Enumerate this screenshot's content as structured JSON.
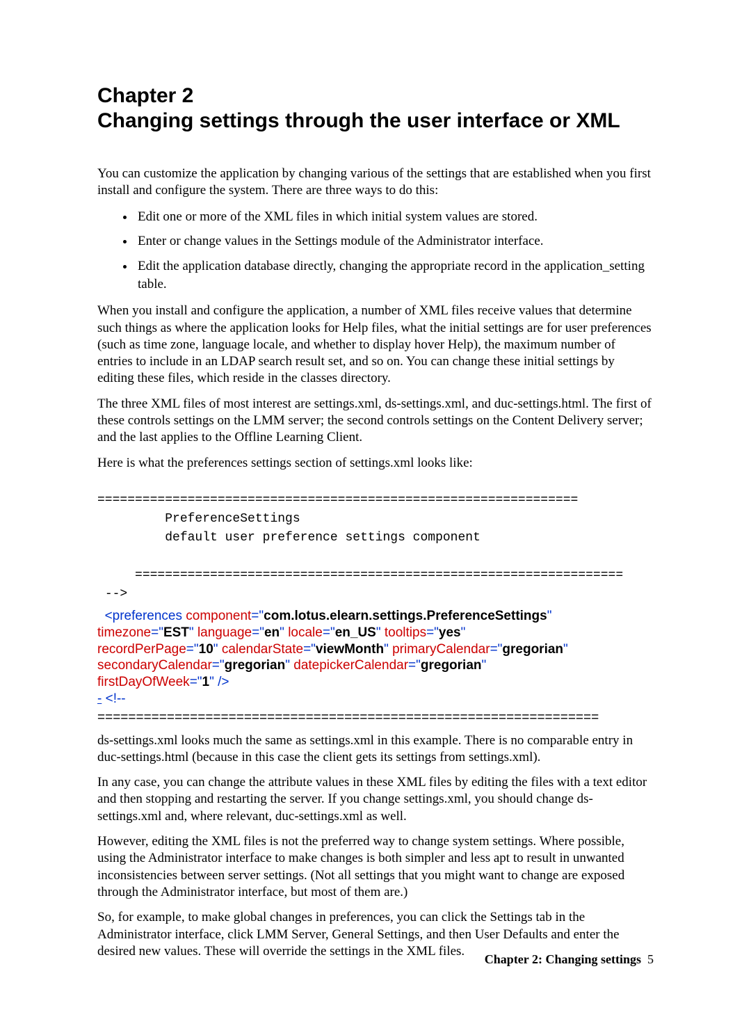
{
  "heading": {
    "chapter": "Chapter 2",
    "title": "Changing settings through the user interface or XML"
  },
  "intro": "You can customize the application by changing various of the settings that are established when you first install and configure the system. There are three ways to do this:",
  "bullets": [
    "Edit one or more of the XML files in which initial system values are stored.",
    "Enter or change values in the Settings module of the Administrator interface.",
    "Edit the application database directly, changing the appropriate record in the application_setting table."
  ],
  "paragraphs": {
    "p1": "When you install and configure the application, a number of XML files receive values that determine such things as where the application looks for Help files, what the initial settings are for user preferences (such as time zone, language locale, and whether to display hover Help), the maximum number of entries to include in an LDAP search result set, and so on.  You can change these initial settings by editing these files, which reside in the classes directory.",
    "p2": "The three XML files of most interest are settings.xml, ds-settings.xml, and duc-settings.html. The first of these controls settings on the LMM server; the second controls settings on the Content Delivery server; and the last applies to the Offline Learning Client.",
    "p3": "Here is what the preferences settings section of settings.xml looks like:"
  },
  "code": {
    "rule": "================================================================",
    "rule2": "=================================================================",
    "line1": "PreferenceSettings",
    "line2": "default user preference settings component",
    "end": "-->"
  },
  "xml": {
    "tag_open": "<preferences",
    "attr1_name": "component",
    "attr1_val": "com.lotus.elearn.settings.PreferenceSettings",
    "attr2_name": "timezone",
    "attr2_val": "EST",
    "attr3_name": "language",
    "attr3_val": "en",
    "attr4_name": "locale",
    "attr4_val": "en_US",
    "attr5_name": "tooltips",
    "attr5_val": "yes",
    "attr6_name": "recordPerPage",
    "attr6_val": "10",
    "attr7_name": "calendarState",
    "attr7_val": "viewMonth",
    "attr8_name": "primaryCalendar",
    "attr8_val": "gregorian",
    "attr9_name": "secondaryCalendar",
    "attr9_val": "gregorian",
    "attr10_name": "datepickerCalendar",
    "attr10_val": "gregorian",
    "attr11_name": "firstDayOfWeek",
    "attr11_val": "1",
    "tag_close": "/>",
    "collapse": "-",
    "next_open": "<!--",
    "eq_rule": "================================================================="
  },
  "after": {
    "p4": "ds-settings.xml looks much the same as settings.xml in this example. There is no comparable entry in duc-settings.html (because in this case the client gets its settings from settings.xml).",
    "p5": "In any case, you can change the attribute values in these XML files by editing the files with a text editor and then stopping and restarting the server. If you change settings.xml, you should change ds-settings.xml and, where relevant, duc-settings.xml as well.",
    "p6": "However, editing the XML files is not the preferred way to change system settings. Where possible, using the Administrator interface to make changes is both simpler and less apt to result in unwanted inconsistencies between server settings. (Not all settings that you might want to change are exposed through the Administrator interface, but most of them are.)",
    "p7": "So, for example, to make global changes in preferences, you can click the Settings tab in the Administrator interface, click LMM Server, General Settings, and then User Defaults and enter the desired new values. These will override the settings in the XML files."
  },
  "footer": {
    "label": "Chapter 2: Changing settings",
    "page": "5"
  }
}
